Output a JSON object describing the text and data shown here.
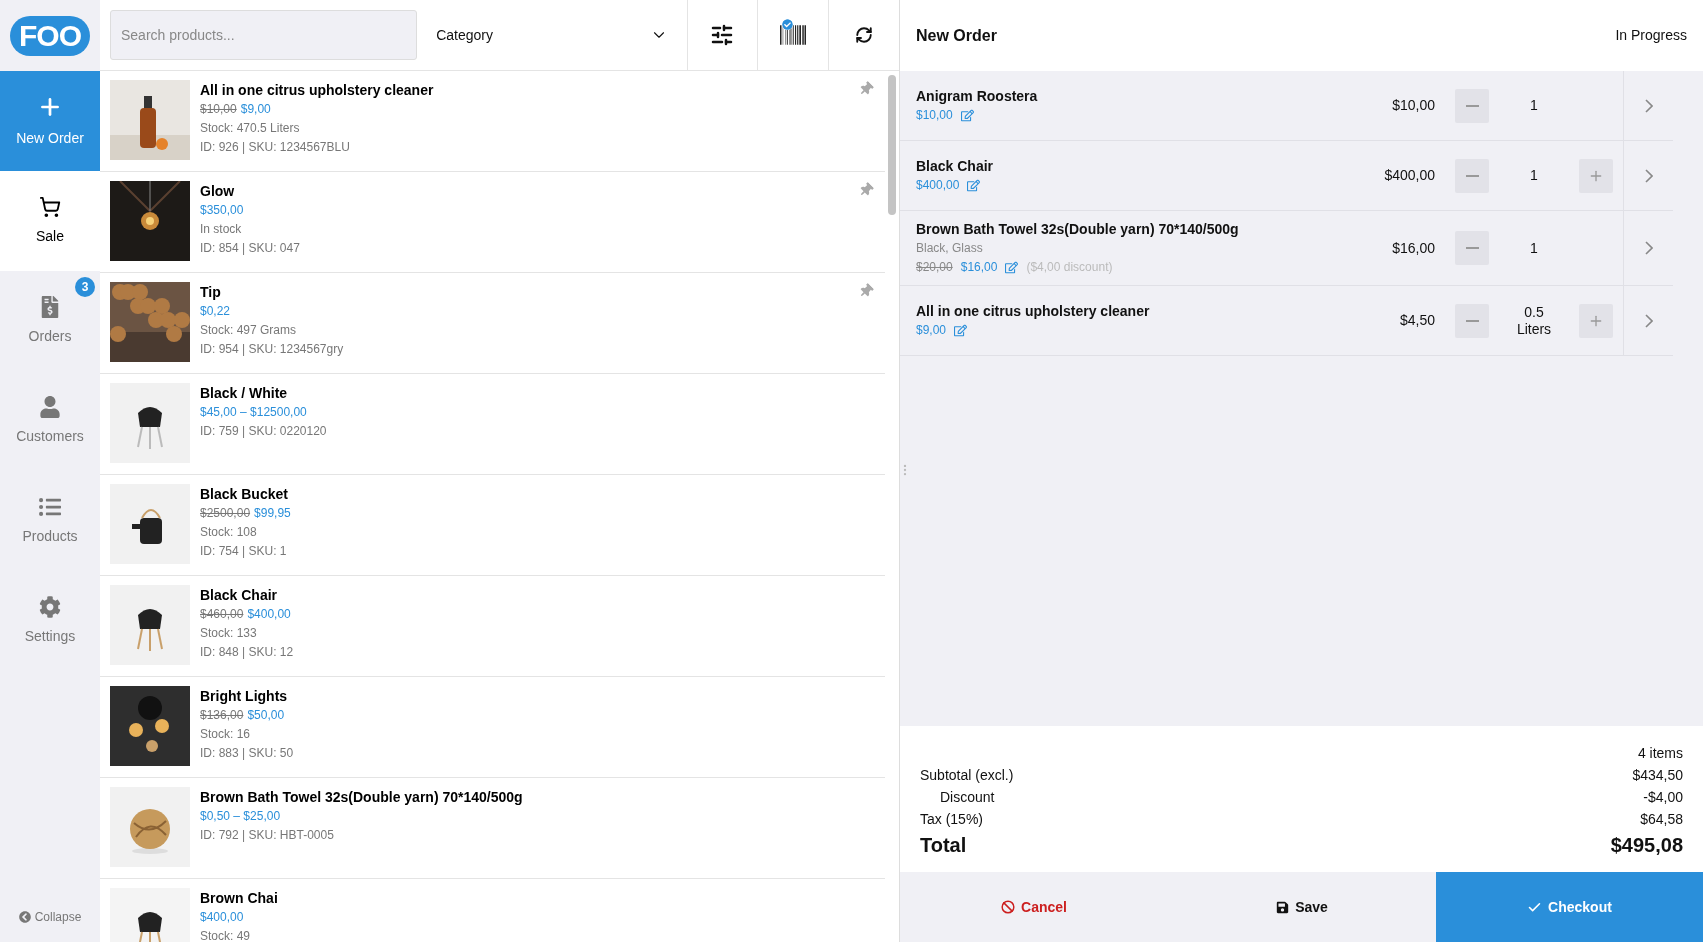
{
  "logo": "FOO",
  "sidebar": {
    "new_order": {
      "label": "New Order"
    },
    "items": [
      {
        "label": "Sale",
        "selected": true
      },
      {
        "label": "Orders",
        "selected": false,
        "badge": "3"
      },
      {
        "label": "Customers",
        "selected": false
      },
      {
        "label": "Products",
        "selected": false
      },
      {
        "label": "Settings",
        "selected": false
      }
    ],
    "collapse": "Collapse"
  },
  "toolbar": {
    "search": {
      "placeholder": "Search products..."
    },
    "category": "Category",
    "barcode_enabled": true
  },
  "products": [
    {
      "name": "All in one citrus upholstery cleaner",
      "regular_price": "$10,00",
      "price": "$9,00",
      "stock": "Stock: 470.5 Liters",
      "meta": "ID: 926 | SKU: 1234567BLU",
      "pinned": true
    },
    {
      "name": "Glow",
      "price": "$350,00",
      "stock": "In stock",
      "meta": "ID: 854 | SKU: 047",
      "pinned": true
    },
    {
      "name": "Tip",
      "price": "$0,22",
      "stock": "Stock: 497 Grams",
      "meta": "ID: 954 | SKU: 1234567gry",
      "pinned": true
    },
    {
      "name": "Black / White",
      "price": "$45,00 – $12500,00",
      "meta": "ID: 759 | SKU: 0220120",
      "pinned": false
    },
    {
      "name": "Black Bucket",
      "regular_price": "$2500,00",
      "price": "$99,95",
      "stock": "Stock: 108",
      "meta": "ID: 754 | SKU: 1",
      "pinned": false
    },
    {
      "name": "Black Chair",
      "regular_price": "$460,00",
      "price": "$400,00",
      "stock": "Stock: 133",
      "meta": "ID: 848 | SKU: 12",
      "pinned": false
    },
    {
      "name": "Bright Lights",
      "regular_price": "$136,00",
      "price": "$50,00",
      "stock": "Stock: 16",
      "meta": "ID: 883 | SKU: 50",
      "pinned": false
    },
    {
      "name": "Brown Bath Towel 32s(Double yarn) 70*140/500g",
      "price": "$0,50 – $25,00",
      "meta": "ID: 792 | SKU: HBT-0005",
      "pinned": false
    },
    {
      "name": "Brown Chai",
      "price": "$400,00",
      "stock": "Stock: 49",
      "pinned": false
    }
  ],
  "order": {
    "title": "New Order",
    "status": "In Progress",
    "items": [
      {
        "name": "Anigram Roostera",
        "price": "$10,00",
        "line_total": "$10,00",
        "qty": "1",
        "can_increase": false
      },
      {
        "name": "Black Chair",
        "price": "$400,00",
        "line_total": "$400,00",
        "qty": "1",
        "can_increase": true
      },
      {
        "name": "Brown Bath Towel 32s(Double yarn) 70*140/500g",
        "variant": "Black, Glass",
        "regular_price": "$20,00",
        "price": "$16,00",
        "discount": "($4,00 discount)",
        "line_total": "$16,00",
        "qty": "1",
        "can_increase": false
      },
      {
        "name": "All in one citrus upholstery cleaner",
        "price": "$9,00",
        "line_total": "$4,50",
        "qty": "0.5",
        "unit": "Liters",
        "can_increase": true
      }
    ],
    "count": "4 items",
    "totals": [
      {
        "label": "Subtotal (excl.)",
        "value": "$434,50",
        "kind": "line"
      },
      {
        "label": "Discount",
        "value": "-$4,00",
        "kind": "indent"
      },
      {
        "label": "Tax (15%)",
        "value": "$64,58",
        "kind": "line"
      },
      {
        "label": "Total",
        "value": "$495,08",
        "kind": "grand"
      }
    ],
    "actions": {
      "cancel": "Cancel",
      "save": "Save",
      "checkout": "Checkout"
    }
  }
}
